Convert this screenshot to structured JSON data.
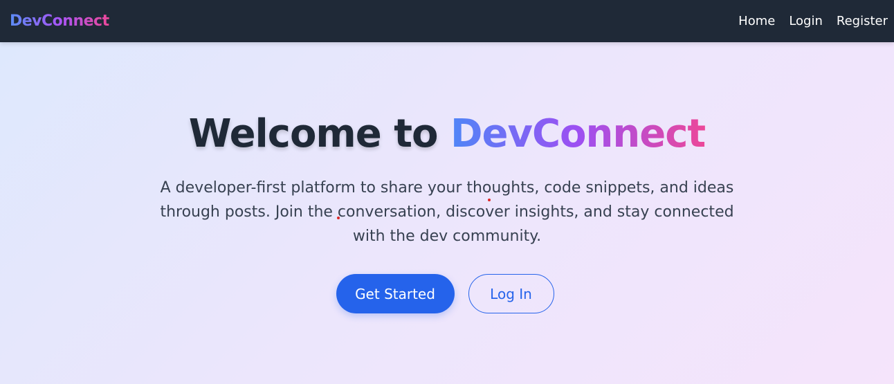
{
  "nav": {
    "brand": "DevConnect",
    "links": [
      "Home",
      "Login",
      "Register"
    ]
  },
  "hero": {
    "title_prefix": "Welcome to ",
    "title_accent": "DevConnect",
    "description": "A developer-first platform to share your thoughts, code snippets, and ideas through posts. Join the conversation, discover insights, and stay connected with the dev community.",
    "primary_button": "Get Started",
    "secondary_button": "Log In"
  },
  "colors": {
    "navbar_bg": "#1f2937",
    "primary": "#2563eb",
    "title_text": "#1f2937",
    "gradient_start": "#4f86f7",
    "gradient_mid": "#9d4ff2",
    "gradient_end": "#ec4899"
  }
}
